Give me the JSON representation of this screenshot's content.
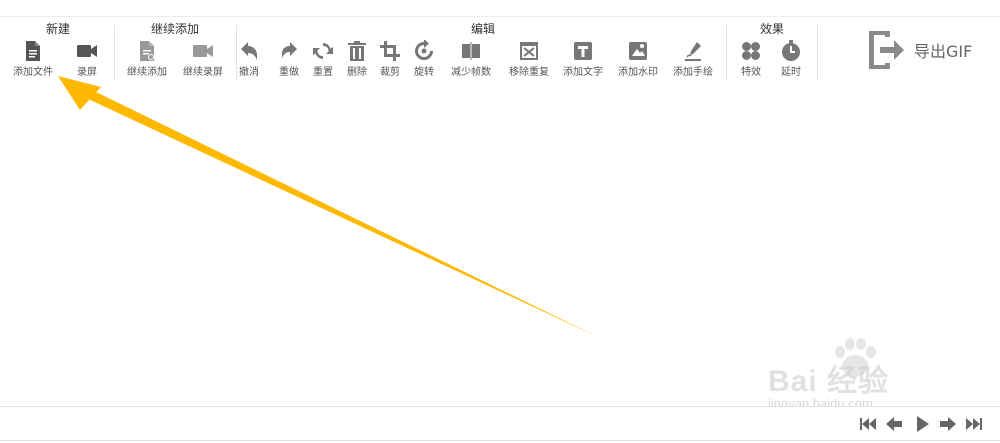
{
  "groups": {
    "new": {
      "title": "新建",
      "add_file": "添加文件",
      "record": "录屏"
    },
    "continue": {
      "title": "继续添加",
      "continue_add": "继续添加",
      "continue_record": "继续录屏"
    },
    "edit": {
      "title": "编辑",
      "undo": "撤消",
      "redo": "重做",
      "reset": "重置",
      "delete": "删除",
      "crop": "裁剪",
      "rotate": "旋转",
      "reduce_frames": "减少帧数",
      "remove_dup": "移除重复",
      "add_text": "添加文字",
      "add_watermark": "添加水印",
      "add_drawing": "添加手绘"
    },
    "effects": {
      "title": "效果",
      "effects": "特效",
      "delay": "延时"
    }
  },
  "export": {
    "label": "导出GIF"
  },
  "watermark": {
    "main": "Bai 经验",
    "sub": "jingyan.baidu.com"
  },
  "colors": {
    "icon_dark": "#555555",
    "icon_grey": "#888888",
    "arrow": "#FFB800"
  }
}
